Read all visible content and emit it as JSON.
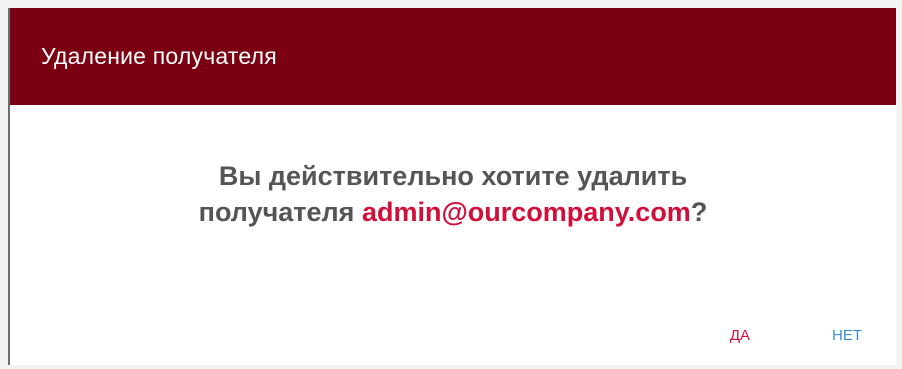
{
  "dialog": {
    "title": "Удаление получателя",
    "message_line1": "Вы действительно хотите удалить",
    "message_line2_prefix": "получателя ",
    "recipient_email": "admin@ourcompany.com",
    "message_suffix": "?",
    "yes_label": "ДА",
    "no_label": "НЕТ"
  },
  "colors": {
    "header_bg": "#7a0012",
    "accent_red": "#d0103a",
    "accent_blue": "#3a8fd6",
    "text_gray": "#555555"
  }
}
